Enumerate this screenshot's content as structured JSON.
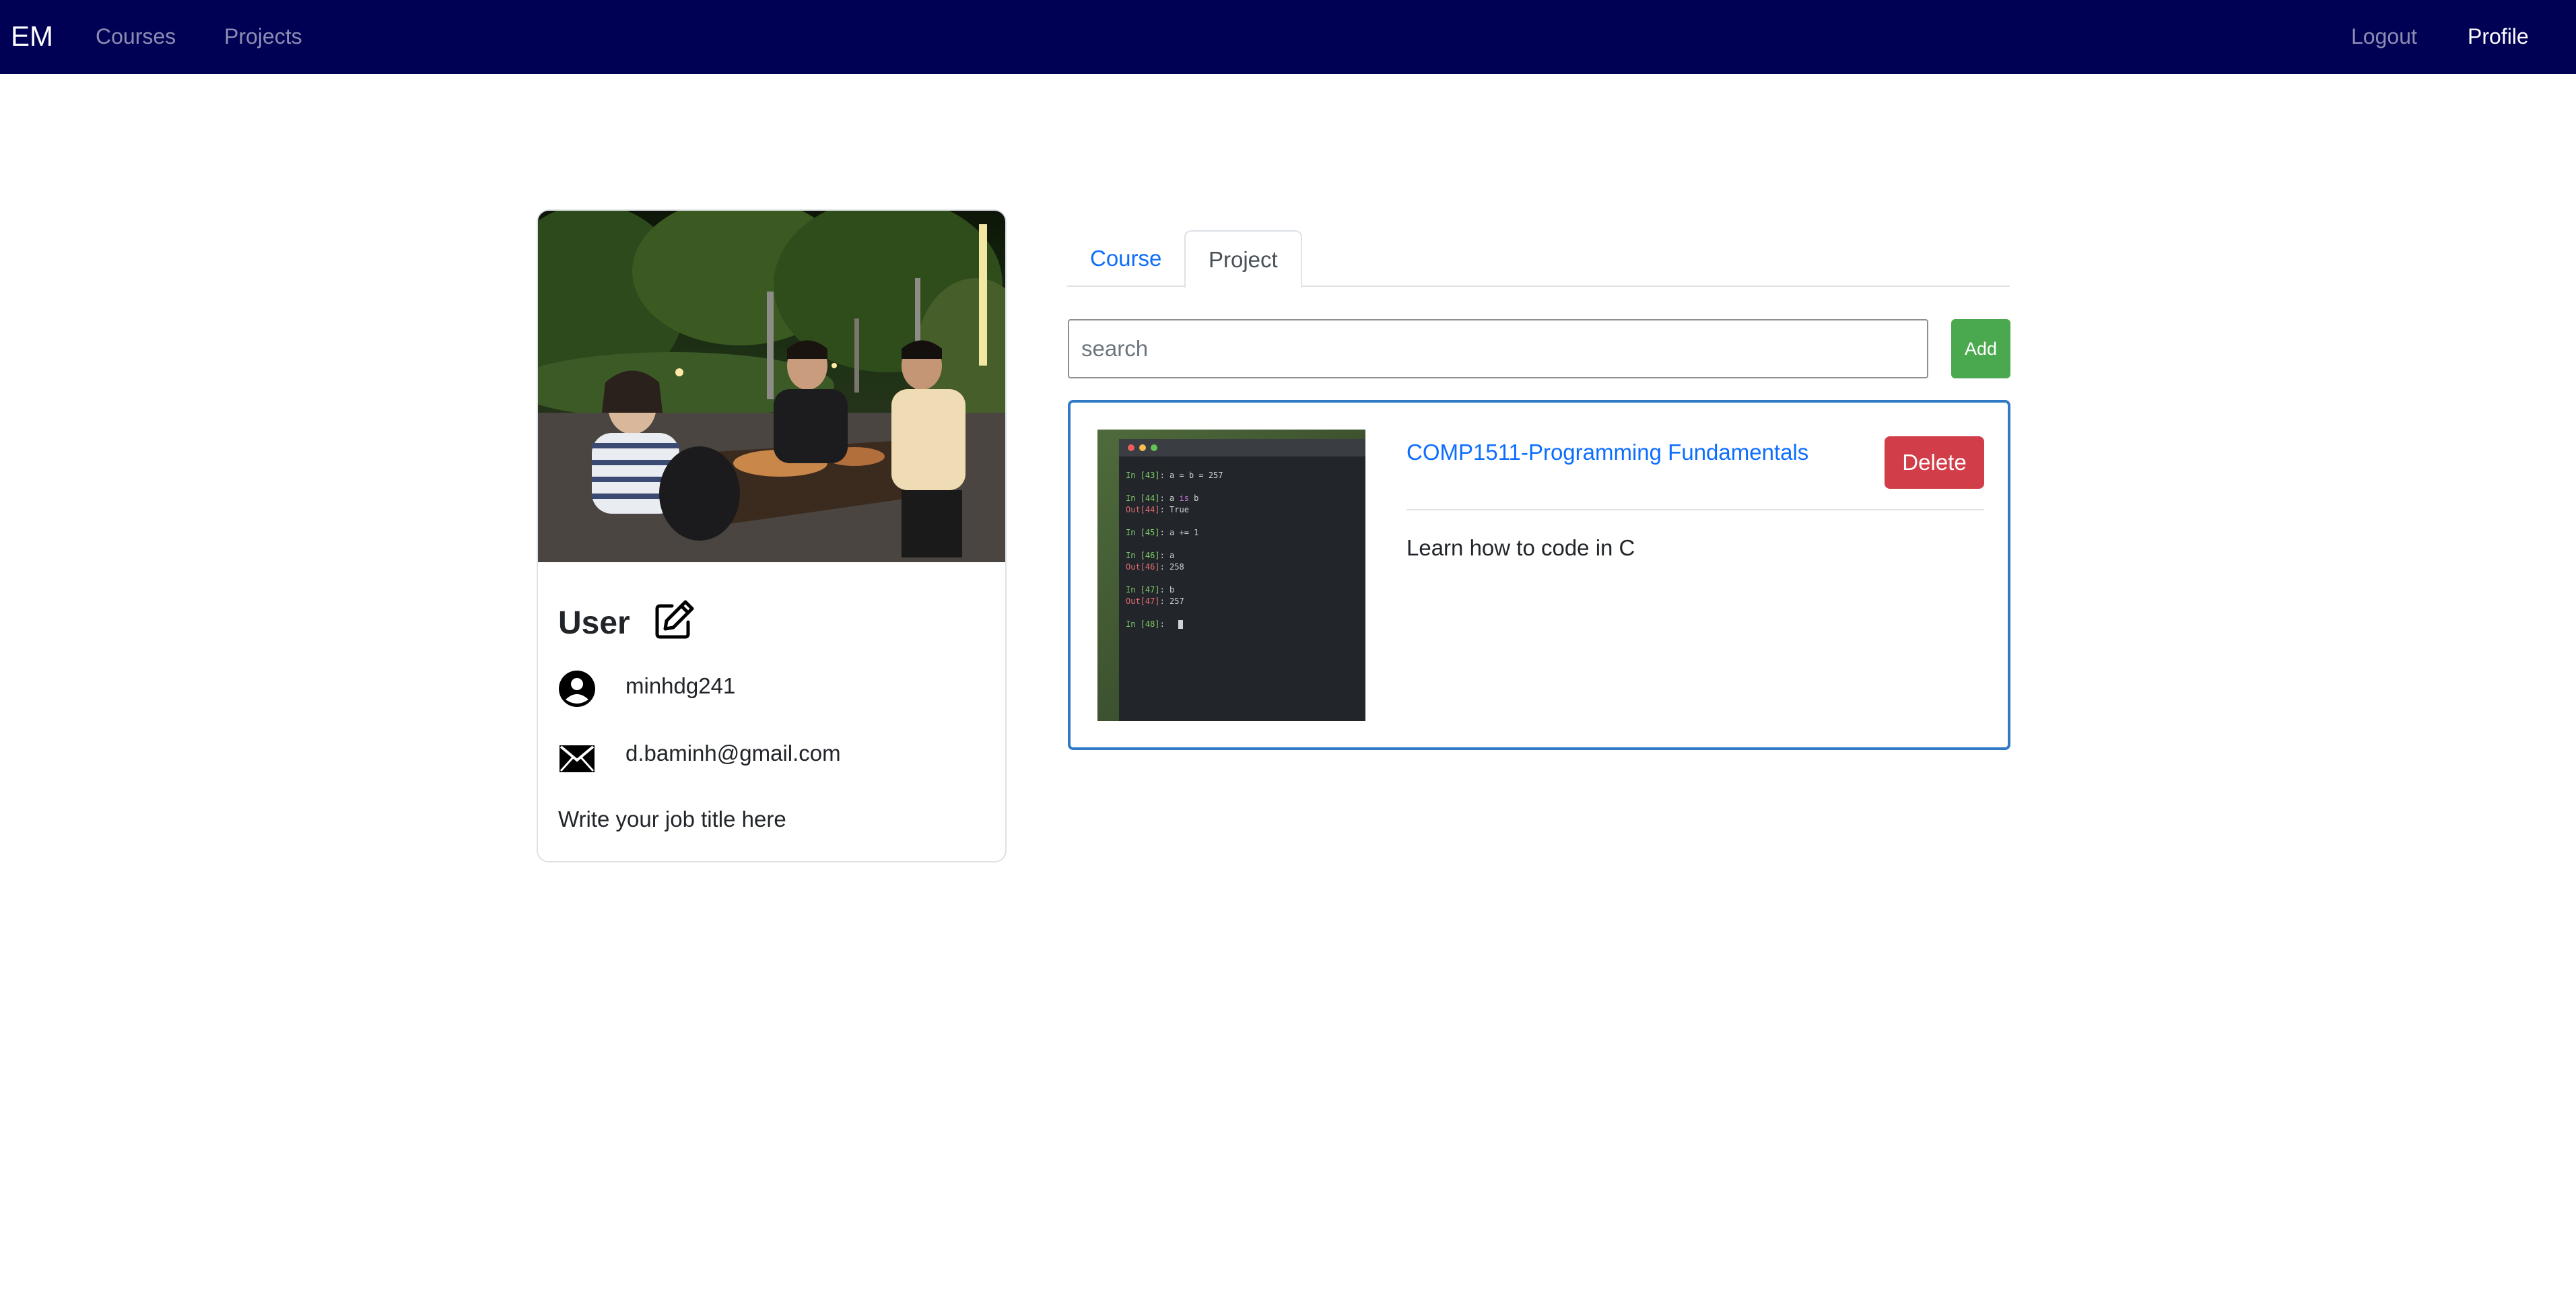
{
  "navbar": {
    "brand": "EM",
    "links": [
      "Courses",
      "Projects"
    ],
    "right_links": [
      "Logout",
      "Profile"
    ],
    "background": "#000055"
  },
  "profile": {
    "name": "User",
    "username": "minhdg241",
    "email": "d.baminh@gmail.com",
    "job_title": "Write your job title here",
    "icons": {
      "edit": "edit-pencil-square-icon",
      "user": "user-circle-icon",
      "email": "envelope-icon"
    }
  },
  "tabs": [
    {
      "label": "Course",
      "active": false
    },
    {
      "label": "Project",
      "active": true
    }
  ],
  "search": {
    "placeholder": "search",
    "value": ""
  },
  "add_button": {
    "label": "Add",
    "color": "#4aa84f"
  },
  "project": {
    "title": "COMP1511-Programming Fundamentals",
    "description": "Learn how to code in C",
    "delete_label": "Delete",
    "delete_color": "#d13d48",
    "border_color": "#2f79c6",
    "terminal_lines": [
      {
        "prompt": "In [43]:",
        "code": "a = b = 257"
      },
      {
        "prompt": "In [44]:",
        "code": "a is b"
      },
      {
        "prompt": "Out[44]:",
        "code": "True"
      },
      {
        "prompt": "In [45]:",
        "code": "a += 1"
      },
      {
        "prompt": "In [46]:",
        "code": "a"
      },
      {
        "prompt": "Out[46]:",
        "code": "258"
      },
      {
        "prompt": "In [47]:",
        "code": "b"
      },
      {
        "prompt": "Out[47]:",
        "code": "257"
      },
      {
        "prompt": "In [48]:",
        "code": ""
      }
    ]
  },
  "colors": {
    "link": "#0d6efd",
    "accent_blue": "#2f79c6"
  }
}
